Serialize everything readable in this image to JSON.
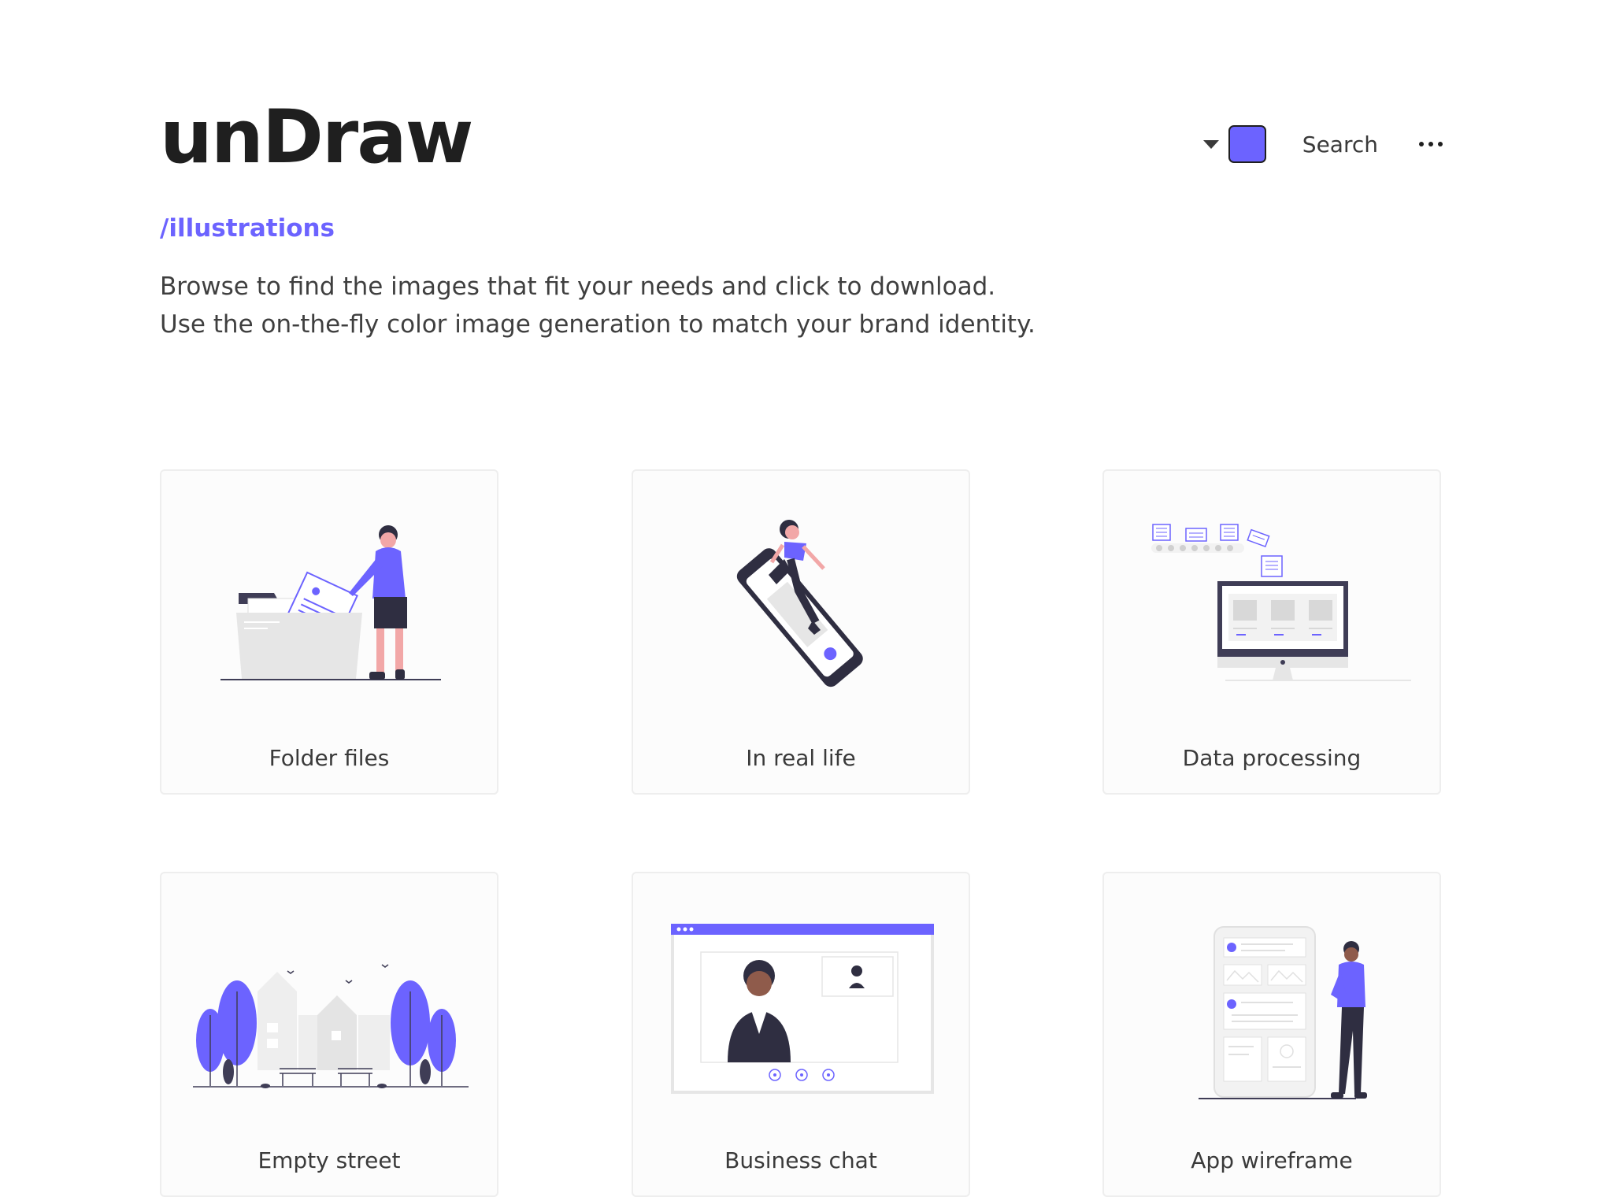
{
  "header": {
    "logo": "unDraw",
    "subtitle": "/illustrations",
    "description": "Browse to find the images that fit your needs and click to download. Use the on-the-fly color image generation to match your brand identity.",
    "search_label": "Search",
    "accent_color": "#6c63ff"
  },
  "icons": {
    "color_picker_caret": "caret-down-icon",
    "more": "more-horizontal-icon"
  },
  "cards": [
    {
      "title": "Folder files"
    },
    {
      "title": "In real life"
    },
    {
      "title": "Data processing"
    },
    {
      "title": "Empty street"
    },
    {
      "title": "Business chat"
    },
    {
      "title": "App wireframe"
    }
  ]
}
